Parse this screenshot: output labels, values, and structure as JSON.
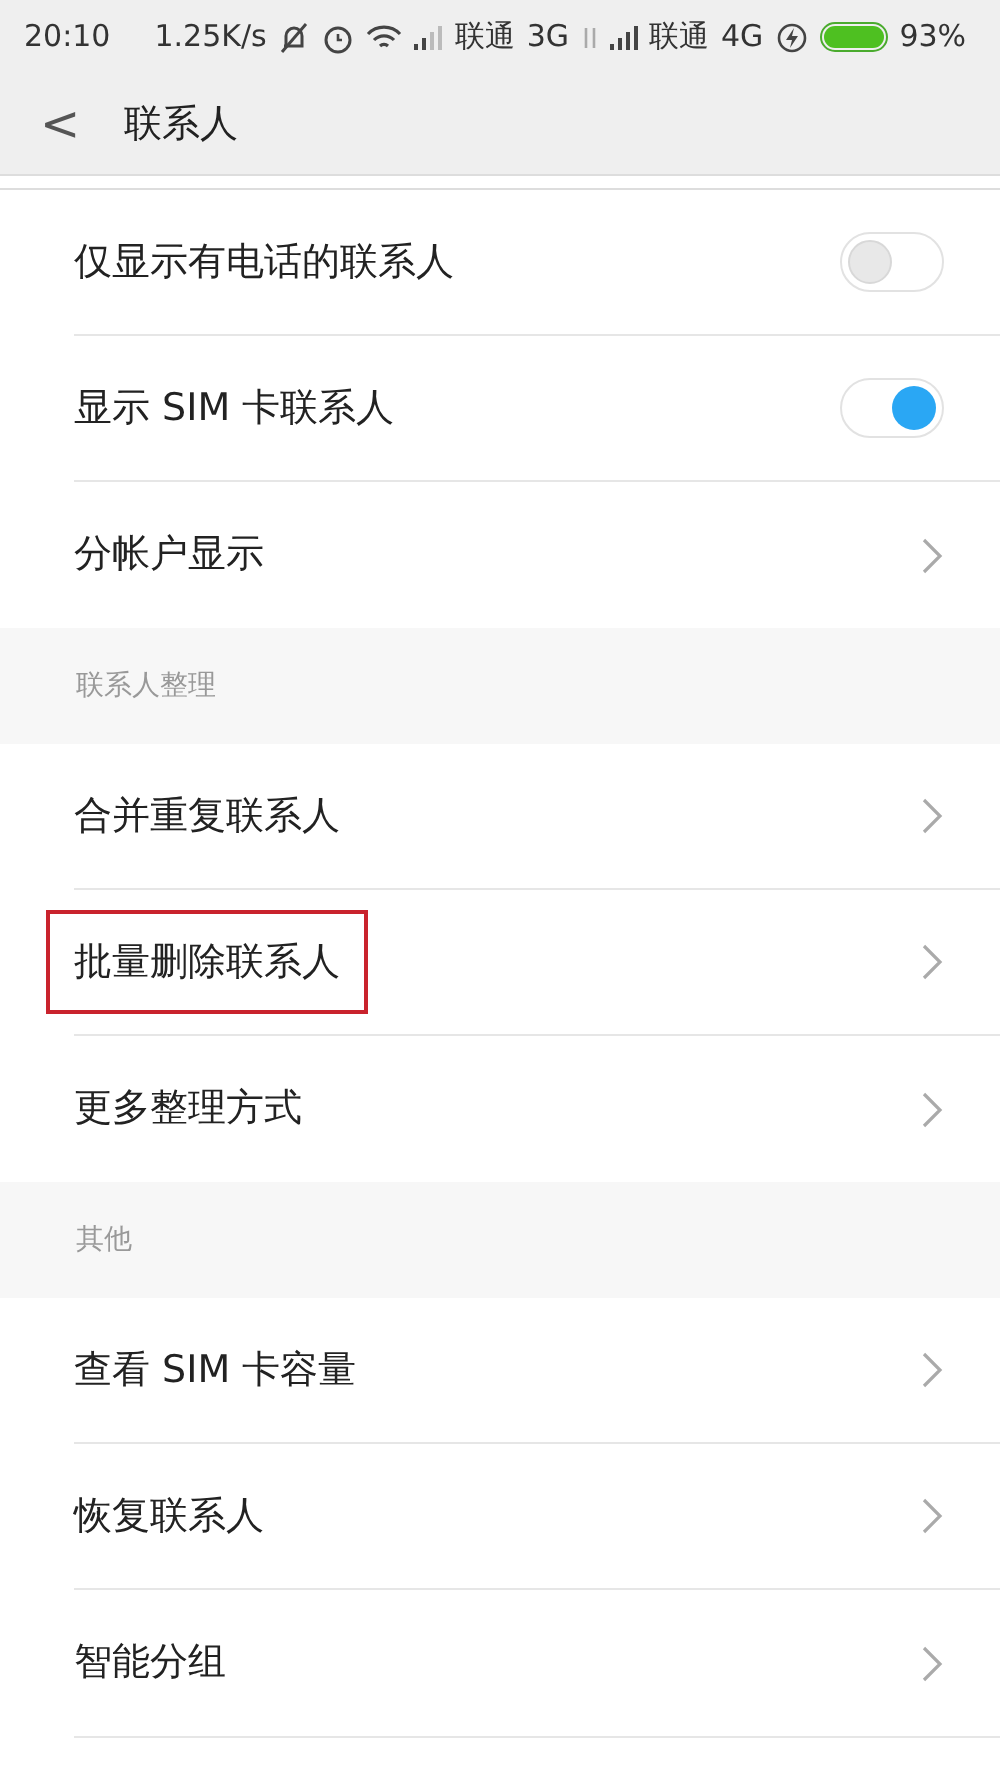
{
  "status_bar": {
    "time": "20:10",
    "speed": "1.25K/s",
    "carrier_1": "联通",
    "network_1": "3G",
    "carrier_2": "联通",
    "network_2": "4G",
    "battery": "93%"
  },
  "header": {
    "back": "<",
    "title": "联系人"
  },
  "sections": [
    {
      "items": [
        {
          "kind": "toggle",
          "label": "仅显示有电话的联系人",
          "on": false
        },
        {
          "kind": "toggle",
          "label": "显示 SIM 卡联系人",
          "on": true
        },
        {
          "kind": "link",
          "label": "分帐户显示",
          "highlighted": false
        }
      ]
    },
    {
      "title": "联系人整理",
      "items": [
        {
          "kind": "link",
          "label": "合并重复联系人",
          "highlighted": false
        },
        {
          "kind": "link",
          "label": "批量删除联系人",
          "highlighted": true
        },
        {
          "kind": "link",
          "label": "更多整理方式",
          "highlighted": false
        }
      ]
    },
    {
      "title": "其他",
      "items": [
        {
          "kind": "link",
          "label": "查看 SIM 卡容量",
          "highlighted": false
        },
        {
          "kind": "link",
          "label": "恢复联系人",
          "highlighted": false
        },
        {
          "kind": "link",
          "label": "智能分组",
          "highlighted": false
        }
      ]
    }
  ]
}
